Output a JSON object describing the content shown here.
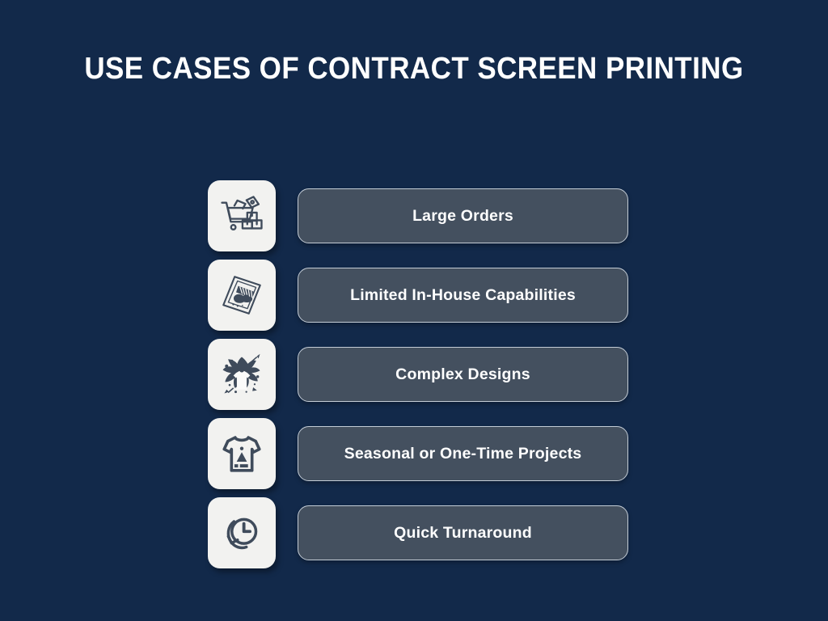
{
  "slide": {
    "background_color": "#12294a",
    "title": "USE CASES OF CONTRACT SCREEN PRINTING",
    "title_color": "#ffffff",
    "pill_fill_color": "#44505f",
    "pill_border_color": "#c3ccd6",
    "tile_color": "#f2f2f0",
    "icon_color": "#3f4b5b"
  },
  "items": [
    {
      "label": "Large Orders",
      "icon": "shopping-cart-boxes-icon"
    },
    {
      "label": "Limited In-House Capabilities",
      "icon": "screen-print-paper-ink-icon"
    },
    {
      "label": "Complex Designs",
      "icon": "ink-splatter-tshirt-icon"
    },
    {
      "label": "Seasonal or One-Time Projects",
      "icon": "tshirt-design-icon"
    },
    {
      "label": "Quick Turnaround",
      "icon": "clock-arrow-icon"
    }
  ]
}
